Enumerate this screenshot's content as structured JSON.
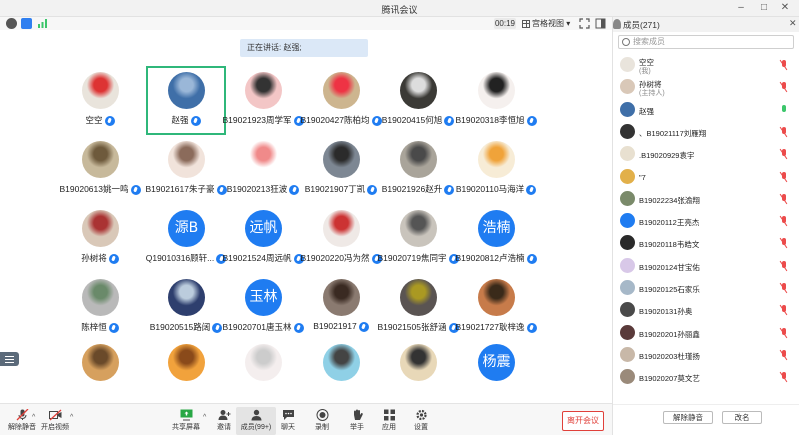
{
  "window": {
    "title": "腾讯会议"
  },
  "toolbar": {
    "timer": "00:19",
    "view_mode": "宫格视图"
  },
  "speaking": "正在讲话: 赵强;",
  "tiles": [
    {
      "name": "空空",
      "avatar": {
        "kind": "img",
        "color": "#e9e4dc",
        "accent": "#d33"
      }
    },
    {
      "name": "赵强",
      "avatar": {
        "kind": "img",
        "color": "#3f6fa8",
        "accent": "#9ab7d8"
      },
      "selected": true
    },
    {
      "name": "B19021923周学军",
      "avatar": {
        "kind": "img",
        "color": "#f3c6c6",
        "accent": "#333"
      }
    },
    {
      "name": "B19020427陈柏均",
      "avatar": {
        "kind": "img",
        "color": "#cdb58f",
        "accent": "#e34"
      }
    },
    {
      "name": "B19020415何旭",
      "avatar": {
        "kind": "img",
        "color": "#3b3a36",
        "accent": "#ddd"
      }
    },
    {
      "name": "B19020318李恒旭",
      "avatar": {
        "kind": "img",
        "color": "#f5f0ee",
        "accent": "#222"
      }
    },
    {
      "name": "B19020613姚一鸣",
      "avatar": {
        "kind": "img",
        "color": "#c7b99b",
        "accent": "#6e5a3c"
      }
    },
    {
      "name": "B19021617朱子豪",
      "avatar": {
        "kind": "img",
        "color": "#f1e3db",
        "accent": "#8b6b5b"
      }
    },
    {
      "name": "B19020213狂波",
      "avatar": {
        "kind": "img",
        "color": "#ffffff",
        "accent": "#f08a8a"
      }
    },
    {
      "name": "B19021907丁凯",
      "avatar": {
        "kind": "img",
        "color": "#7d8793",
        "accent": "#2b2b2b"
      }
    },
    {
      "name": "B19021926赵升",
      "avatar": {
        "kind": "img",
        "color": "#a9a49a",
        "accent": "#4a4a4a"
      }
    },
    {
      "name": "B19020110马海洋",
      "avatar": {
        "kind": "img",
        "color": "#f7ecd6",
        "accent": "#f0a33a"
      }
    },
    {
      "name": "孙树将",
      "avatar": {
        "kind": "img",
        "color": "#d9c8b8",
        "accent": "#a33"
      }
    },
    {
      "name": "Q19010316顾轩...",
      "avatar": {
        "kind": "text",
        "text": "源B"
      }
    },
    {
      "name": "B19021524周远帆",
      "avatar": {
        "kind": "text",
        "text": "远帆"
      }
    },
    {
      "name": "B19020220冯为然",
      "avatar": {
        "kind": "img",
        "color": "#efe9e6",
        "accent": "#c33"
      }
    },
    {
      "name": "B19020719焦同宇",
      "avatar": {
        "kind": "img",
        "color": "#c9c4bc",
        "accent": "#555"
      }
    },
    {
      "name": "B19020812卢浩楠",
      "avatar": {
        "kind": "text",
        "text": "浩楠"
      }
    },
    {
      "name": "陈梓恒",
      "avatar": {
        "kind": "img",
        "color": "#b9b9b9",
        "accent": "#6a8a6a"
      }
    },
    {
      "name": "B19020515路阔",
      "avatar": {
        "kind": "img",
        "color": "#2e3f6e",
        "accent": "#bcd"
      }
    },
    {
      "name": "B19020701唐玉林",
      "avatar": {
        "kind": "text",
        "text": "玉林"
      }
    },
    {
      "name": "B19021917",
      "avatar": {
        "kind": "img",
        "color": "#8a7a70",
        "accent": "#3a2a22"
      }
    },
    {
      "name": "B19021505张舒涵",
      "avatar": {
        "kind": "img",
        "color": "#5a5452",
        "accent": "#a92"
      }
    },
    {
      "name": "B19021727耿梓逸",
      "avatar": {
        "kind": "img",
        "color": "#c77b4a",
        "accent": "#3a2a1a"
      }
    },
    {
      "name": "",
      "avatar": {
        "kind": "img",
        "color": "#d6a05e",
        "accent": "#6a4a2a"
      }
    },
    {
      "name": "",
      "avatar": {
        "kind": "img",
        "color": "#f1a23c",
        "accent": "#8a4a1a"
      }
    },
    {
      "name": "",
      "avatar": {
        "kind": "img",
        "color": "#f4eeee",
        "accent": "#ccc"
      }
    },
    {
      "name": "",
      "avatar": {
        "kind": "img",
        "color": "#8fd0e6",
        "accent": "#444"
      }
    },
    {
      "name": "",
      "avatar": {
        "kind": "img",
        "color": "#e8d8b8",
        "accent": "#333"
      }
    },
    {
      "name": "",
      "avatar": {
        "kind": "text",
        "text": "杨震"
      }
    }
  ],
  "bottombar": {
    "unmute": "解除静音",
    "video": "开启视频",
    "share": "共享屏幕",
    "invite": "邀请",
    "members": "成员(99+)",
    "chat": "聊天",
    "record": "录制",
    "raise": "举手",
    "apps": "应用",
    "settings": "设置",
    "leave": "离开会议"
  },
  "panel": {
    "title": "成员(271)",
    "search_placeholder": "搜索成员",
    "members": [
      {
        "name": "空空",
        "sub": "(我)",
        "color": "#e9e4dc",
        "mic": "off"
      },
      {
        "name": "孙树将",
        "sub": "(主持人)",
        "color": "#d9c8b8",
        "mic": "off"
      },
      {
        "name": "赵强",
        "color": "#3f6fa8",
        "mic": "on"
      },
      {
        "name": "、B19021117刘雁翔",
        "color": "#333333",
        "mic": "off"
      },
      {
        "name": ".B19020929袁宇",
        "color": "#e8e0d0",
        "mic": "off"
      },
      {
        "name": "\"7",
        "color": "#e2b04a",
        "mic": "off"
      },
      {
        "name": "B19022234张渝翔",
        "color": "#7a8a6a",
        "mic": "off"
      },
      {
        "name": "B19020112王亮杰",
        "color": "#1f7cf1",
        "mic": "off"
      },
      {
        "name": "B19020118韦皓文",
        "color": "#2a2a2a",
        "mic": "off"
      },
      {
        "name": "B19020124甘宝佑",
        "color": "#d8c8e8",
        "mic": "off"
      },
      {
        "name": "B19020125石家乐",
        "color": "#a6b8c8",
        "mic": "off"
      },
      {
        "name": "B19020131孙奥",
        "color": "#4a4a4a",
        "mic": "off"
      },
      {
        "name": "B19020201孙丽鑫",
        "color": "#5a3a3a",
        "mic": "off"
      },
      {
        "name": "B19020203杜瑾扬",
        "color": "#c8b8a8",
        "mic": "off"
      },
      {
        "name": "B19020207莫文艺",
        "color": "#9a8a7a",
        "mic": "off"
      }
    ],
    "unmute_all": "解除静音",
    "rename": "改名"
  }
}
